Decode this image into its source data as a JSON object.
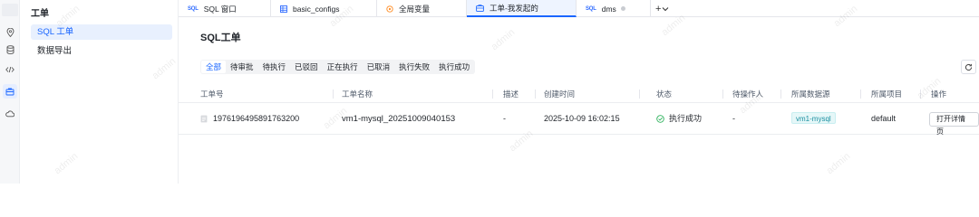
{
  "left_nav": {
    "title": "工单",
    "items": [
      {
        "label": "SQL 工单",
        "active": true
      },
      {
        "label": "数据导出",
        "active": false
      }
    ]
  },
  "rail_icons": [
    "location-icon",
    "database-icon",
    "code-icon",
    "ticket-icon",
    "cloud-icon"
  ],
  "tabs": [
    {
      "label": "SQL 窗口",
      "icon": "sql-tag-icon"
    },
    {
      "label": "basic_configs",
      "icon": "table-icon"
    },
    {
      "label": "全局变量",
      "icon": "variable-icon"
    },
    {
      "label": "工单-我发起的",
      "icon": "ticket-icon",
      "active": true
    },
    {
      "label": "dms",
      "icon": "sql-tag-icon"
    }
  ],
  "tab_add_label": "+",
  "page_title": "SQL工单",
  "filters": [
    "全部",
    "待审批",
    "待执行",
    "已驳回",
    "正在执行",
    "已取消",
    "执行失败",
    "执行成功"
  ],
  "active_filter": "全部",
  "table": {
    "columns": [
      "工单号",
      "工单名称",
      "描述",
      "创建时间",
      "状态",
      "待操作人",
      "所属数据源",
      "所属项目",
      "操作"
    ],
    "rows": [
      {
        "id": "1976196495891763200",
        "name": "vm1-mysql_20251009040153",
        "description": "-",
        "created": "2025-10-09 16:02:15",
        "status": "执行成功",
        "operator": "-",
        "datasource": "vm1-mysql",
        "project": "default",
        "action": "打开详情页"
      }
    ]
  },
  "watermark_text": "admin",
  "colors": {
    "accent": "#1a66ff",
    "success": "#2cb15b",
    "badge": "#1a8fa0"
  }
}
